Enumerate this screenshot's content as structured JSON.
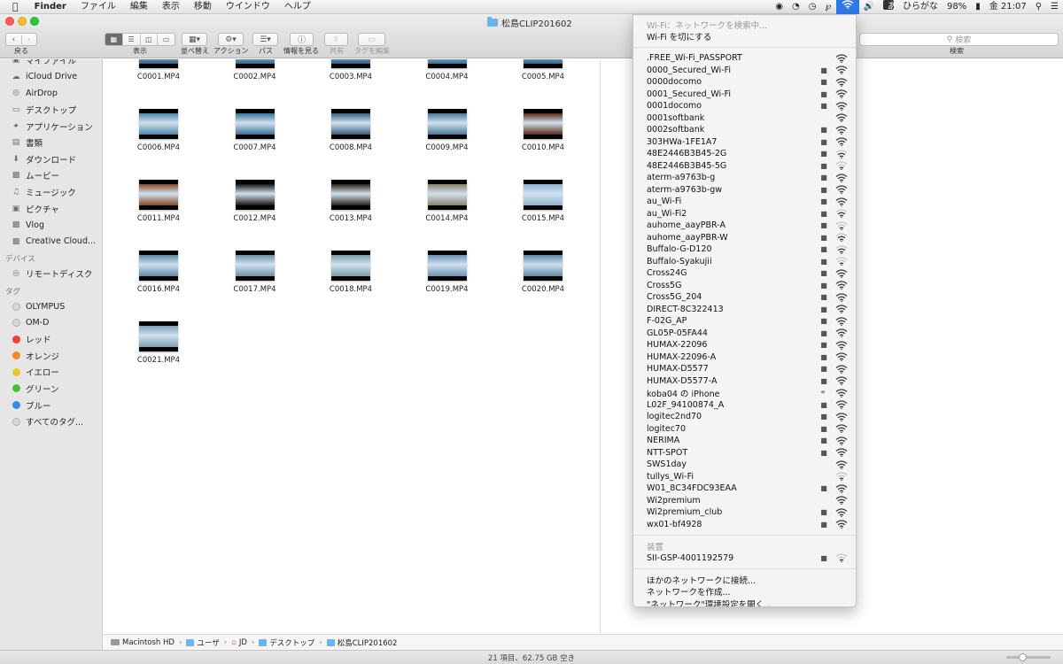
{
  "menubar": {
    "apple": "",
    "app": "Finder",
    "items": [
      "ファイル",
      "編集",
      "表示",
      "移動",
      "ウインドウ",
      "ヘルプ"
    ],
    "status": {
      "input_method": "ひらがな",
      "input_badge": "あ",
      "battery": "98%",
      "clock": "金 21:07"
    }
  },
  "window": {
    "title": "松島CLIP201602",
    "toolbar": {
      "back_label": "戻る",
      "view_label": "表示",
      "arrange_label": "並べ替え",
      "action_label": "アクション",
      "path_label": "パス",
      "info_label": "情報を見る",
      "share_label": "共有",
      "tag_label": "タグを編集",
      "search_placeholder": "検索",
      "search_label": "検索"
    }
  },
  "sidebar": {
    "items": [
      {
        "label": "マイファイル",
        "icon": "all-my-files-icon"
      },
      {
        "label": "iCloud Drive",
        "icon": "cloud-icon"
      },
      {
        "label": "AirDrop",
        "icon": "airdrop-icon"
      },
      {
        "label": "デスクトップ",
        "icon": "desktop-icon"
      },
      {
        "label": "アプリケーション",
        "icon": "applications-icon"
      },
      {
        "label": "書類",
        "icon": "document-icon"
      },
      {
        "label": "ダウンロード",
        "icon": "download-icon"
      },
      {
        "label": "ムービー",
        "icon": "movie-icon"
      },
      {
        "label": "ミュージック",
        "icon": "music-icon"
      },
      {
        "label": "ピクチャ",
        "icon": "camera-icon"
      },
      {
        "label": "Vlog",
        "icon": "folder-icon"
      },
      {
        "label": "Creative Cloud...",
        "icon": "folder-icon"
      }
    ],
    "devices_header": "デバイス",
    "devices": [
      {
        "label": "リモートディスク",
        "icon": "disc-icon"
      }
    ],
    "tags_header": "タグ",
    "tags": [
      {
        "label": "OLYMPUS",
        "color": "#d8d8d8"
      },
      {
        "label": "OM-D",
        "color": "#d8d8d8"
      },
      {
        "label": "レッド",
        "color": "#e8413e"
      },
      {
        "label": "オレンジ",
        "color": "#f08a24"
      },
      {
        "label": "イエロー",
        "color": "#e9c62e"
      },
      {
        "label": "グリーン",
        "color": "#4cbb3c"
      },
      {
        "label": "ブルー",
        "color": "#2f8de4"
      },
      {
        "label": "すべてのタグ...",
        "color": "#d8d8d8"
      }
    ]
  },
  "files": [
    {
      "name": "C0001.MP4",
      "tint": "#2d5d86"
    },
    {
      "name": "C0002.MP4",
      "tint": "#2f6690"
    },
    {
      "name": "C0003.MP4",
      "tint": "#2b5b84"
    },
    {
      "name": "C0004.MP4",
      "tint": "#336f9a"
    },
    {
      "name": "C0005.MP4",
      "tint": "#2e6289"
    },
    {
      "name": "C0006.MP4",
      "tint": "#4e86a8"
    },
    {
      "name": "C0007.MP4",
      "tint": "#3c7296"
    },
    {
      "name": "C0008.MP4",
      "tint": "#385f7d"
    },
    {
      "name": "C0009.MP4",
      "tint": "#4a7898"
    },
    {
      "name": "C0010.MP4",
      "tint": "#5a2a18"
    },
    {
      "name": "C0011.MP4",
      "tint": "#8a4a28"
    },
    {
      "name": "C0012.MP4",
      "tint": "#1a1612"
    },
    {
      "name": "C0013.MP4",
      "tint": "#2a231a"
    },
    {
      "name": "C0014.MP4",
      "tint": "#8c8270"
    },
    {
      "name": "C0015.MP4",
      "tint": "#8fb4cf"
    },
    {
      "name": "C0016.MP4",
      "tint": "#5f8aa4"
    },
    {
      "name": "C0017.MP4",
      "tint": "#6e92a6"
    },
    {
      "name": "C0018.MP4",
      "tint": "#7d9ea8"
    },
    {
      "name": "C0019.MP4",
      "tint": "#6a94b4"
    },
    {
      "name": "C0020.MP4",
      "tint": "#5d8aa6"
    },
    {
      "name": "C0021.MP4",
      "tint": "#7ea0b6"
    }
  ],
  "pathbar": {
    "segments": [
      "Macintosh HD",
      "ユーザ",
      "JD",
      "デスクトップ",
      "松島CLIP201602"
    ]
  },
  "statusbar": {
    "text": "21 項目、62.75 GB 空き",
    "zoom_level": 0.35
  },
  "wifi_menu": {
    "status": "Wi-Fi：ネットワークを検索中...",
    "toggle": "Wi-Fi を切にする",
    "networks": [
      {
        "name": ".FREE_Wi-Fi_PASSPORT",
        "locked": false,
        "hotspot": false,
        "strength": 3
      },
      {
        "name": "0000_Secured_Wi-Fi",
        "locked": true,
        "hotspot": false,
        "strength": 3
      },
      {
        "name": "0000docomo",
        "locked": true,
        "hotspot": false,
        "strength": 3
      },
      {
        "name": "0001_Secured_Wi-Fi",
        "locked": true,
        "hotspot": false,
        "strength": 3
      },
      {
        "name": "0001docomo",
        "locked": true,
        "hotspot": false,
        "strength": 3
      },
      {
        "name": "0001softbank",
        "locked": false,
        "hotspot": false,
        "strength": 3
      },
      {
        "name": "0002softbank",
        "locked": true,
        "hotspot": false,
        "strength": 3
      },
      {
        "name": "303HWa-1FE1A7",
        "locked": true,
        "hotspot": false,
        "strength": 3
      },
      {
        "name": "48E2446B3B45-2G",
        "locked": true,
        "hotspot": false,
        "strength": 2
      },
      {
        "name": "48E2446B3B45-5G",
        "locked": true,
        "hotspot": false,
        "strength": 1
      },
      {
        "name": "aterm-a9763b-g",
        "locked": true,
        "hotspot": false,
        "strength": 3
      },
      {
        "name": "aterm-a9763b-gw",
        "locked": true,
        "hotspot": false,
        "strength": 3
      },
      {
        "name": "au_Wi-Fi",
        "locked": true,
        "hotspot": false,
        "strength": 3
      },
      {
        "name": "au_Wi-Fi2",
        "locked": true,
        "hotspot": false,
        "strength": 2
      },
      {
        "name": "auhome_aayPBR-A",
        "locked": true,
        "hotspot": false,
        "strength": 1
      },
      {
        "name": "auhome_aayPBR-W",
        "locked": true,
        "hotspot": false,
        "strength": 2
      },
      {
        "name": "Buffalo-G-D120",
        "locked": true,
        "hotspot": false,
        "strength": 2
      },
      {
        "name": "Buffalo-Syakujii",
        "locked": true,
        "hotspot": false,
        "strength": 1
      },
      {
        "name": "Cross24G",
        "locked": true,
        "hotspot": false,
        "strength": 3
      },
      {
        "name": "Cross5G",
        "locked": true,
        "hotspot": false,
        "strength": 3
      },
      {
        "name": "Cross5G_204",
        "locked": true,
        "hotspot": false,
        "strength": 3
      },
      {
        "name": "DIRECT-8C322413",
        "locked": true,
        "hotspot": false,
        "strength": 3
      },
      {
        "name": "F-02G_AP",
        "locked": true,
        "hotspot": false,
        "strength": 3
      },
      {
        "name": "GL05P-05FA44",
        "locked": true,
        "hotspot": false,
        "strength": 3
      },
      {
        "name": "HUMAX-22096",
        "locked": true,
        "hotspot": false,
        "strength": 3
      },
      {
        "name": "HUMAX-22096-A",
        "locked": true,
        "hotspot": false,
        "strength": 3
      },
      {
        "name": "HUMAX-D5577",
        "locked": true,
        "hotspot": false,
        "strength": 3
      },
      {
        "name": "HUMAX-D5577-A",
        "locked": true,
        "hotspot": false,
        "strength": 3
      },
      {
        "name": "koba04 の iPhone",
        "locked": false,
        "hotspot": true,
        "strength": 3
      },
      {
        "name": "L02F_94100874_A",
        "locked": true,
        "hotspot": false,
        "strength": 3
      },
      {
        "name": "logitec2nd70",
        "locked": true,
        "hotspot": false,
        "strength": 3
      },
      {
        "name": "logitec70",
        "locked": true,
        "hotspot": false,
        "strength": 3
      },
      {
        "name": "NERIMA",
        "locked": true,
        "hotspot": false,
        "strength": 3
      },
      {
        "name": "NTT-SPOT",
        "locked": true,
        "hotspot": false,
        "strength": 3
      },
      {
        "name": "SWS1day",
        "locked": false,
        "hotspot": false,
        "strength": 3
      },
      {
        "name": "tullys_Wi-Fi",
        "locked": false,
        "hotspot": false,
        "strength": 1
      },
      {
        "name": "W01_8C34FDC93EAA",
        "locked": true,
        "hotspot": false,
        "strength": 3
      },
      {
        "name": "Wi2premium",
        "locked": false,
        "hotspot": false,
        "strength": 3
      },
      {
        "name": "Wi2premium_club",
        "locked": true,
        "hotspot": false,
        "strength": 3
      },
      {
        "name": "wx01-bf4928",
        "locked": true,
        "hotspot": false,
        "strength": 3
      }
    ],
    "devices_header": "装置",
    "devices": [
      {
        "name": "SII-GSP-4001192579",
        "locked": true,
        "hotspot": false,
        "strength": 1
      }
    ],
    "actions": [
      "ほかのネットワークに接続...",
      "ネットワークを作成...",
      "\"ネットワーク\"環境設定を開く..."
    ]
  },
  "colors": {
    "accent": "#2f7ae5",
    "sidebar_bg": "#e6e6e6"
  }
}
